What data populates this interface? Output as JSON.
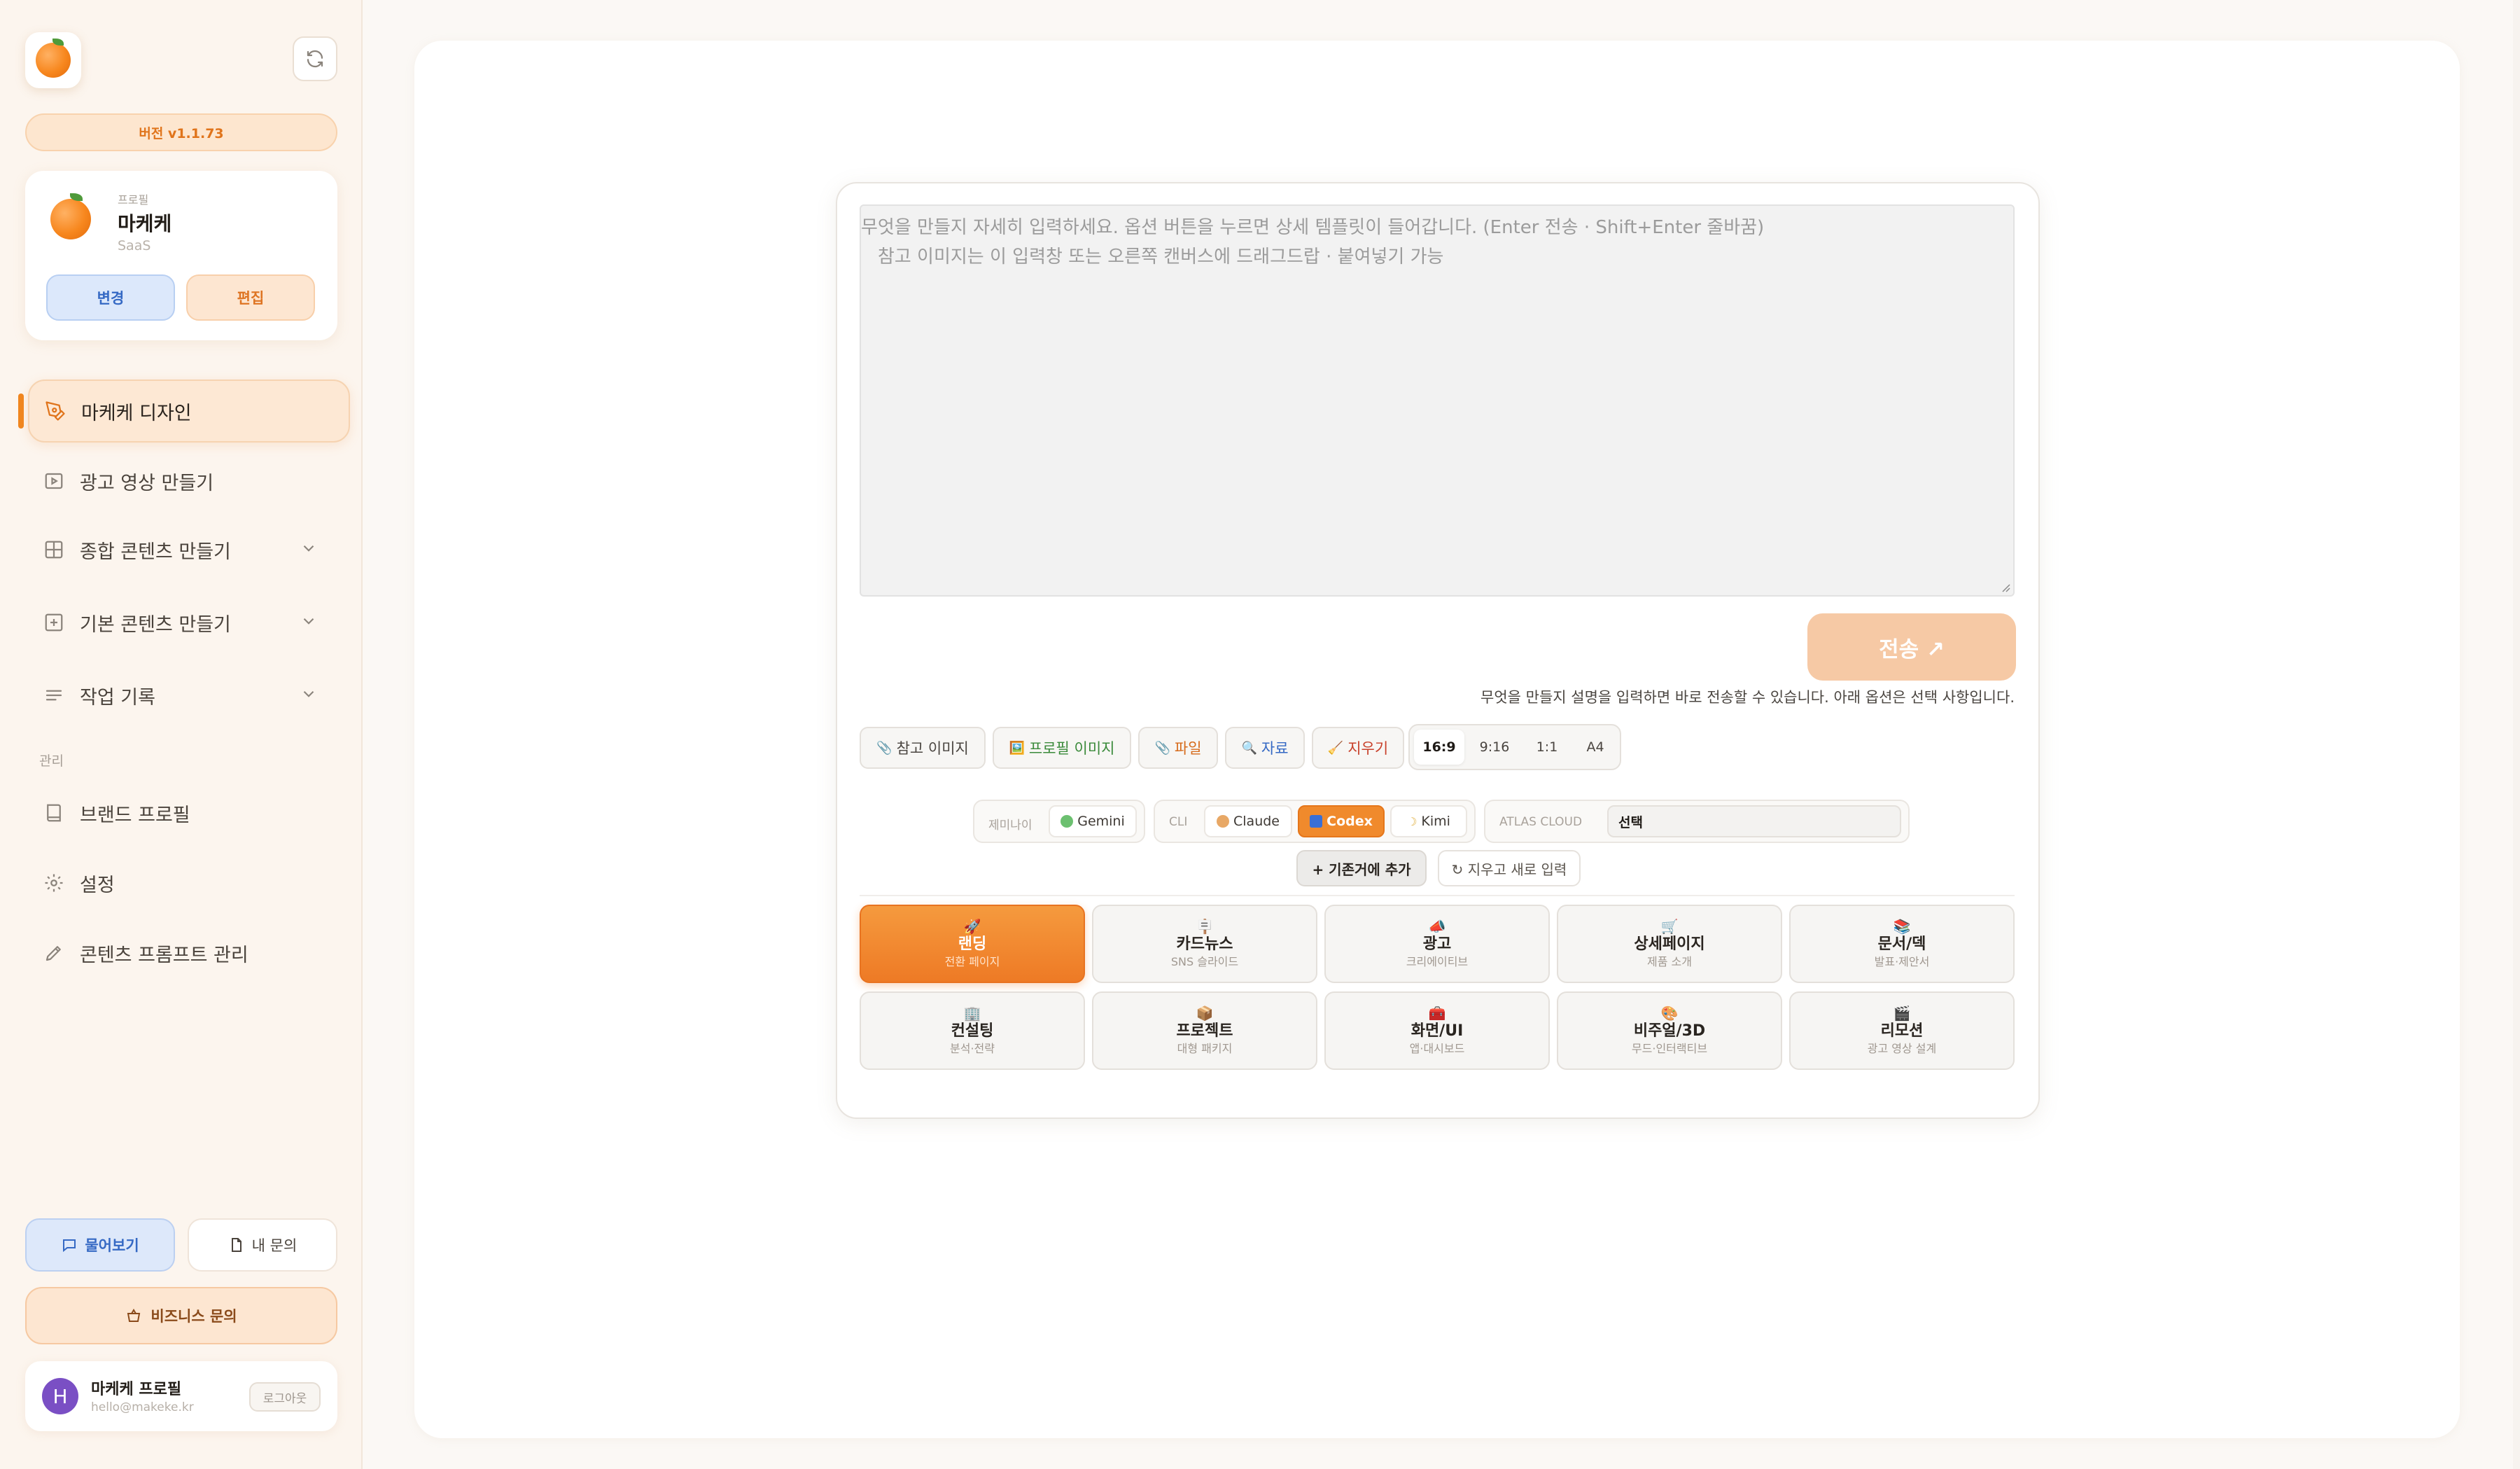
{
  "sidebar": {
    "version": "버전 v1.1.73",
    "profile": {
      "label": "프로필",
      "name": "마케케",
      "type": "SaaS",
      "change_label": "변경",
      "edit_label": "편집"
    },
    "nav": [
      {
        "label": "마케케 디자인",
        "icon": "pen-nib-icon",
        "active": true
      },
      {
        "label": "광고 영상 만들기",
        "icon": "video-icon"
      },
      {
        "label": "종합 콘텐츠 만들기",
        "icon": "grid-icon",
        "expandable": true
      },
      {
        "label": "기본 콘텐츠 만들기",
        "icon": "plus-square-icon",
        "expandable": true
      },
      {
        "label": "작업 기록",
        "icon": "list-icon",
        "expandable": true
      }
    ],
    "section_label": "관리",
    "admin_nav": [
      {
        "label": "브랜드 프로필",
        "icon": "book-icon"
      },
      {
        "label": "설정",
        "icon": "gear-icon"
      },
      {
        "label": "콘텐츠 프롬프트 관리",
        "icon": "pencil-icon"
      }
    ],
    "ask_label": "물어보기",
    "my_inquiry_label": "내 문의",
    "business_label": "비즈니스 문의",
    "user": {
      "initial": "H",
      "name": "마케케 프로필",
      "email": "hello@makeke.kr",
      "logout_label": "로그아웃"
    }
  },
  "composer": {
    "placeholder_line1": "무엇을 만들지 자세히 입력하세요. 옵션 버튼을 누르면 상세 템플릿이 들어갑니다. (Enter 전송 · Shift+Enter 줄바꿈)",
    "placeholder_line2": "ㅤ참고 이미지는 이 입력창 또는 오른쪽 캔버스에 드래그드랍 · 붙여넣기 가능",
    "send_label": "전송 ↗",
    "hint": "무엇을 만들지 설명을 입력하면 바로 전송할 수 있습니다. 아래 옵션은 선택 사항입니다.",
    "attach_chips": [
      {
        "icon": "📎",
        "label": "참고 이미지",
        "color": "#4a4540"
      },
      {
        "icon": "🖼️",
        "label": "프로필 이미지",
        "color": "#3a8a3a"
      },
      {
        "icon": "📎",
        "label": "파일",
        "color": "#d66a1a"
      },
      {
        "icon": "🔍",
        "label": "자료",
        "color": "#3569c4"
      },
      {
        "icon": "🧹",
        "label": "지우기",
        "color": "#c8402a"
      }
    ],
    "ratios": [
      "16:9",
      "9:16",
      "1:1",
      "A4"
    ],
    "selected_ratio": "16:9",
    "gemini_label": "제미나이",
    "gemini_option": "Gemini",
    "cli_label": "CLI",
    "cli_options": [
      "Claude",
      "Codex",
      "Kimi"
    ],
    "selected_cli": "Codex",
    "atlas_label": "ATLAS CLOUD",
    "atlas_value": "선택",
    "add_label": "+ 기존거에 추가",
    "clear_label": "↻ 지우고 새로 입력",
    "templates": [
      {
        "icon": "🚀",
        "title": "랜딩",
        "sub": "전환 페이지",
        "selected": true
      },
      {
        "icon": "🪧",
        "title": "카드뉴스",
        "sub": "SNS 슬라이드"
      },
      {
        "icon": "📣",
        "title": "광고",
        "sub": "크리에이티브"
      },
      {
        "icon": "🛒",
        "title": "상세페이지",
        "sub": "제품 소개"
      },
      {
        "icon": "📚",
        "title": "문서/덱",
        "sub": "발표·제안서"
      },
      {
        "icon": "🏢",
        "title": "컨설팅",
        "sub": "분석·전략"
      },
      {
        "icon": "📦",
        "title": "프로젝트",
        "sub": "대형 패키지"
      },
      {
        "icon": "🧰",
        "title": "화면/UI",
        "sub": "앱·대시보드"
      },
      {
        "icon": "🎨",
        "title": "비주얼/3D",
        "sub": "무드·인터랙티브"
      },
      {
        "icon": "🎬",
        "title": "리모션",
        "sub": "광고 영상 설계"
      }
    ]
  },
  "colors": {
    "accent": "#f0861f",
    "sidebar_bg": "#fcf5ee",
    "send_disabled": "#f6c9a5"
  }
}
